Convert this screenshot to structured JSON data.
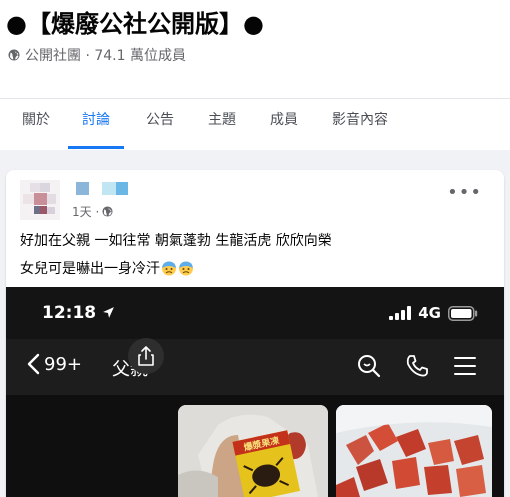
{
  "group": {
    "title": "●【爆廢公社公開版】●",
    "meta": "公開社團 · 74.1 萬位成員"
  },
  "tabs": [
    {
      "label": "關於"
    },
    {
      "label": "討論",
      "active": true
    },
    {
      "label": "公告"
    },
    {
      "label": "主題"
    },
    {
      "label": "成員"
    },
    {
      "label": "影音內容"
    }
  ],
  "post": {
    "time": "1天 ·",
    "text_line1": "好加在父親 一如往常 朝氣蓬勃 生龍活虎 欣欣向榮",
    "text_line2": "女兒可是嚇出一身冷汗",
    "emoji": [
      "cold-sweat-emoji",
      "cold-sweat-emoji"
    ]
  },
  "photo": {
    "clock": "12:18",
    "network": "4G",
    "back_count": "99+",
    "chat_title": "父親"
  },
  "colors": {
    "accent": "#1877f2",
    "text": "#050505",
    "muted": "#65676b",
    "page_bg": "#f0f2f5"
  }
}
